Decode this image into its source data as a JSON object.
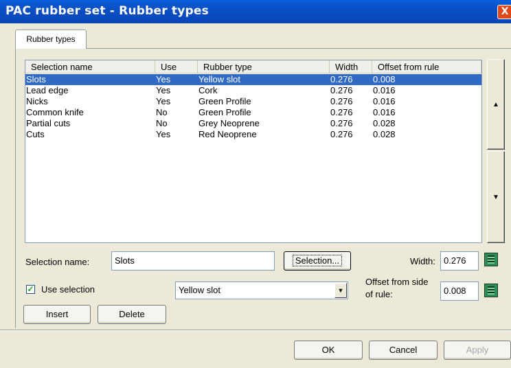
{
  "window": {
    "title": "PAC rubber set - Rubber types",
    "close_glyph": "X"
  },
  "tabs": [
    {
      "label": "Rubber types"
    }
  ],
  "table": {
    "columns": [
      "Selection name",
      "Use",
      "Rubber type",
      "Width",
      "Offset from rule"
    ],
    "rows": [
      [
        "Slots",
        "Yes",
        "Yellow slot",
        "0.276",
        "0.008"
      ],
      [
        "Lead edge",
        "Yes",
        "Cork",
        "0.276",
        "0.016"
      ],
      [
        "Nicks",
        "Yes",
        "Green Profile",
        "0.276",
        "0.016"
      ],
      [
        "Common knife",
        "No",
        "Green Profile",
        "0.276",
        "0.016"
      ],
      [
        "Partial cuts",
        "No",
        "Grey Neoprene",
        "0.276",
        "0.028"
      ],
      [
        "Cuts",
        "Yes",
        "Red Neoprene",
        "0.276",
        "0.028"
      ]
    ],
    "selected_row": 0
  },
  "scroll": {
    "up_glyph": "▲",
    "down_glyph": "▼"
  },
  "form": {
    "selection_name_label": "Selection name:",
    "selection_name_value": "Slots",
    "selection_button": "Selection...",
    "width_label": "Width:",
    "width_value": "0.276",
    "use_selection_label": "Use selection",
    "use_selection_checked": true,
    "checkmark": "✓",
    "rubber_type_value": "Yellow slot",
    "dropdown_arrow": "▼",
    "offset_label_line1": "Offset from side",
    "offset_label_line2": "of rule:",
    "offset_value": "0.008",
    "insert_button": "Insert",
    "delete_button": "Delete"
  },
  "footer": {
    "ok": "OK",
    "cancel": "Cancel",
    "apply": "Apply"
  },
  "icons": {
    "calculator": "calculator-icon"
  },
  "colors": {
    "title_bar": "#0A4FC4",
    "selection": "#316AC5",
    "dialog": "#ECE9D8"
  }
}
